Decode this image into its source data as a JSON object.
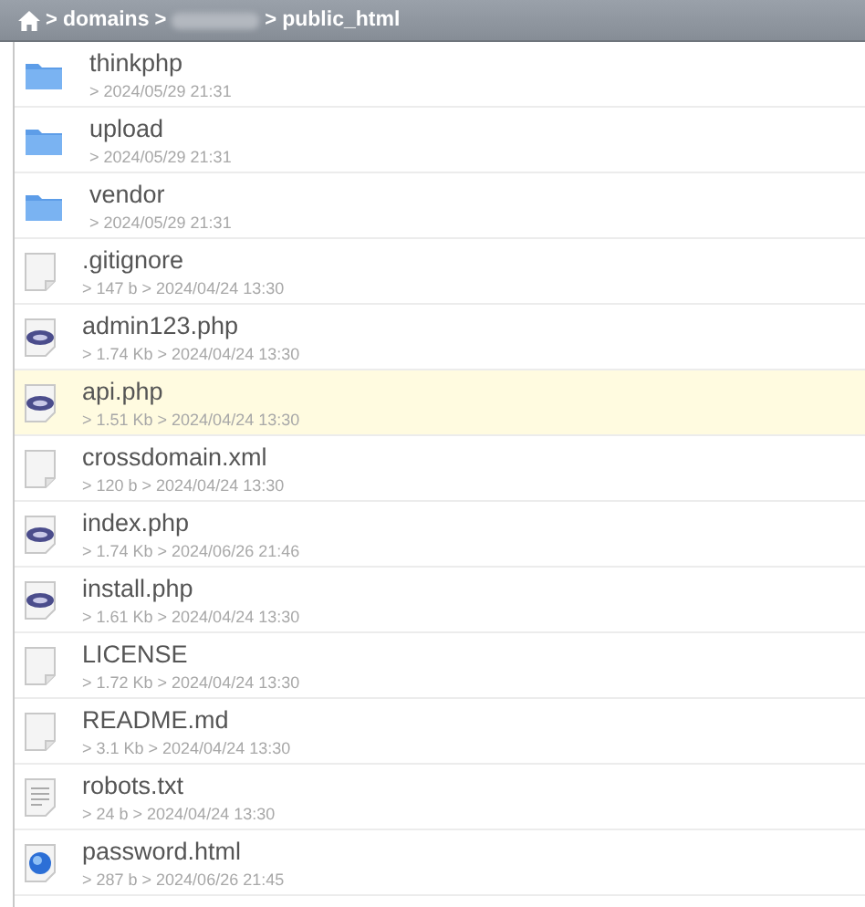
{
  "breadcrumb": {
    "items": [
      {
        "kind": "home"
      },
      {
        "kind": "text",
        "label": "domains"
      },
      {
        "kind": "hidden"
      },
      {
        "kind": "text",
        "label": "public_html"
      }
    ],
    "separator": ">"
  },
  "files": [
    {
      "name": "thinkphp",
      "kind": "folder",
      "meta": [
        "2024/05/29 21:31"
      ],
      "selected": false
    },
    {
      "name": "upload",
      "kind": "folder",
      "meta": [
        "2024/05/29 21:31"
      ],
      "selected": false
    },
    {
      "name": "vendor",
      "kind": "folder",
      "meta": [
        "2024/05/29 21:31"
      ],
      "selected": false
    },
    {
      "name": ".gitignore",
      "kind": "file",
      "meta": [
        "147 b",
        "2024/04/24 13:30"
      ],
      "selected": false
    },
    {
      "name": "admin123.php",
      "kind": "php",
      "meta": [
        "1.74 Kb",
        "2024/04/24 13:30"
      ],
      "selected": false
    },
    {
      "name": "api.php",
      "kind": "php",
      "meta": [
        "1.51 Kb",
        "2024/04/24 13:30"
      ],
      "selected": true
    },
    {
      "name": "crossdomain.xml",
      "kind": "file",
      "meta": [
        "120 b",
        "2024/04/24 13:30"
      ],
      "selected": false
    },
    {
      "name": "index.php",
      "kind": "php",
      "meta": [
        "1.74 Kb",
        "2024/06/26 21:46"
      ],
      "selected": false
    },
    {
      "name": "install.php",
      "kind": "php",
      "meta": [
        "1.61 Kb",
        "2024/04/24 13:30"
      ],
      "selected": false
    },
    {
      "name": "LICENSE",
      "kind": "file",
      "meta": [
        "1.72 Kb",
        "2024/04/24 13:30"
      ],
      "selected": false
    },
    {
      "name": "README.md",
      "kind": "file",
      "meta": [
        "3.1 Kb",
        "2024/04/24 13:30"
      ],
      "selected": false
    },
    {
      "name": "robots.txt",
      "kind": "text",
      "meta": [
        "24 b",
        "2024/04/24 13:30"
      ],
      "selected": false
    },
    {
      "name": "password.html",
      "kind": "html",
      "meta": [
        "287 b",
        "2024/06/26 21:45"
      ],
      "selected": false
    }
  ],
  "meta_separator": ">"
}
